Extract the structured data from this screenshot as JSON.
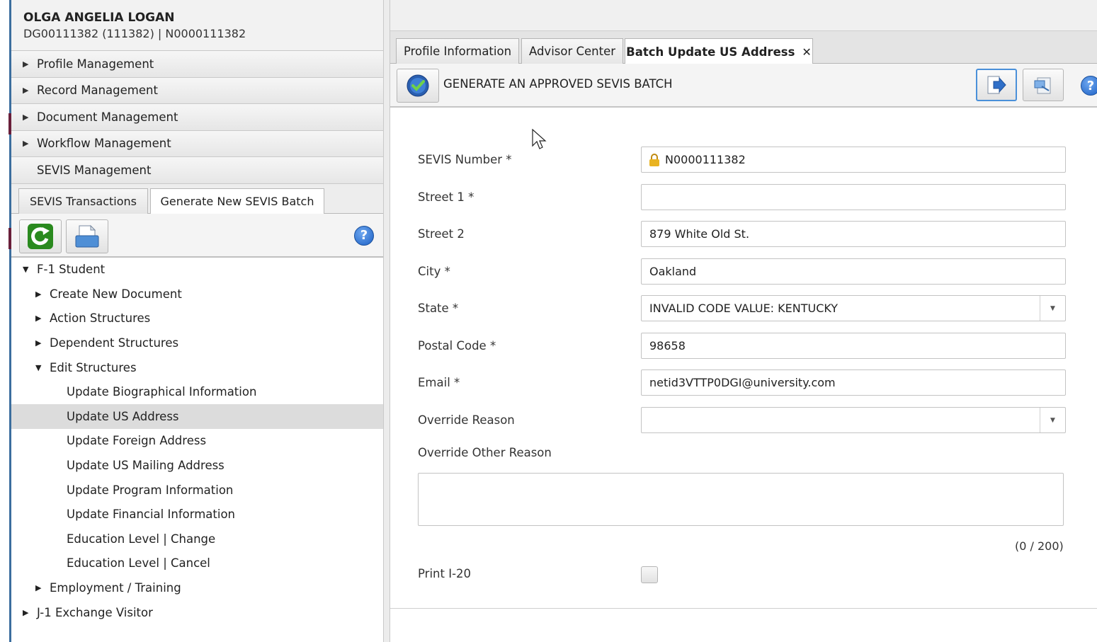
{
  "profile": {
    "name": "OLGA ANGELIA LOGAN",
    "ids": "DG00111382 (111382) | N0000111382"
  },
  "sidebar": {
    "accordion": [
      {
        "label": "Profile Management"
      },
      {
        "label": "Record Management"
      },
      {
        "label": "Document Management"
      },
      {
        "label": "Workflow Management"
      },
      {
        "label": "SEVIS Management"
      }
    ],
    "tabs": [
      {
        "label": "SEVIS Transactions"
      },
      {
        "label": "Generate New SEVIS Batch"
      }
    ],
    "active_tab": "Generate New SEVIS Batch",
    "tree": [
      {
        "label": "F-1 Student",
        "expanded": true
      },
      {
        "label": "Create New Document",
        "expanded": false
      },
      {
        "label": "Action Structures",
        "expanded": false
      },
      {
        "label": "Dependent Structures",
        "expanded": false
      },
      {
        "label": "Edit Structures",
        "expanded": true
      },
      {
        "label": "Update Biographical Information"
      },
      {
        "label": "Update US Address",
        "selected": true
      },
      {
        "label": "Update Foreign Address"
      },
      {
        "label": "Update US Mailing Address"
      },
      {
        "label": "Update Program Information"
      },
      {
        "label": "Update Financial Information"
      },
      {
        "label": "Education Level | Change"
      },
      {
        "label": "Education Level | Cancel"
      },
      {
        "label": "Employment / Training",
        "expanded": false
      },
      {
        "label": "J-1 Exchange Visitor",
        "expanded": false
      }
    ]
  },
  "main": {
    "tabs": [
      {
        "label": "Profile Information"
      },
      {
        "label": "Advisor Center"
      },
      {
        "label": "Batch Update US Address",
        "closable": true
      }
    ],
    "active_tab": "Batch Update US Address",
    "close_glyph": "✕",
    "action_label": "GENERATE AN APPROVED SEVIS BATCH",
    "form": {
      "sevis_number": {
        "label": "SEVIS Number *",
        "value": "N0000111382",
        "locked": true
      },
      "street1": {
        "label": "Street 1 *",
        "value": ""
      },
      "street2": {
        "label": "Street 2",
        "value": "879 White Old St."
      },
      "city": {
        "label": "City *",
        "value": "Oakland"
      },
      "state": {
        "label": "State *",
        "value": "INVALID CODE VALUE: KENTUCKY"
      },
      "postal_code": {
        "label": "Postal Code *",
        "value": "98658"
      },
      "email": {
        "label": "Email *",
        "value": "netid3VTTP0DGI@university.com"
      },
      "override_reason": {
        "label": "Override Reason",
        "value": ""
      },
      "override_other_reason": {
        "label": "Override Other Reason",
        "value": ""
      },
      "char_counter": "(0 / 200)",
      "print_i20": {
        "label": "Print I-20",
        "checked": false
      }
    }
  },
  "help_glyph": "?",
  "colors": {
    "accent": "#4a90d9",
    "help_blue": "#1b5fc4",
    "refresh_green": "#2a8a1f",
    "lock_gold": "#e9b321",
    "selected_row": "#dcdcdc"
  }
}
